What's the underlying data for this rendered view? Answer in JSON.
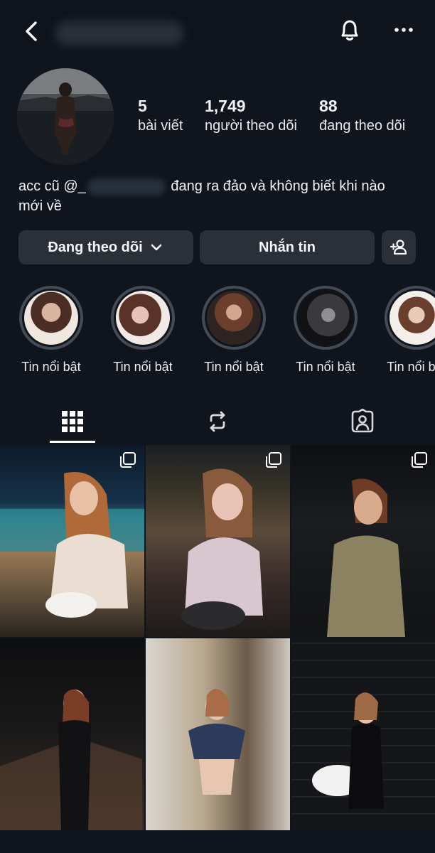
{
  "header": {
    "back_icon": "chevron-left-icon",
    "bell_icon": "bell-icon",
    "more_icon": "more-horizontal-icon"
  },
  "profile": {
    "stats": [
      {
        "value": "5",
        "label": "bài viết"
      },
      {
        "value": "1,749",
        "label": "người theo dõi"
      },
      {
        "value": "88",
        "label": "đang theo dõi"
      }
    ],
    "bio_before": "acc cũ @_",
    "bio_after": " đang ra đảo và không biết khi nào",
    "bio_line2": "mới về"
  },
  "actions": {
    "following_label": "Đang theo dõi",
    "message_label": "Nhắn tin",
    "add_user_icon": "add-person-icon"
  },
  "highlights": [
    {
      "label": "Tin nổi bật"
    },
    {
      "label": "Tin nổi bật"
    },
    {
      "label": "Tin nổi bật"
    },
    {
      "label": "Tin nổi bật"
    },
    {
      "label": "Tin nổi bật"
    }
  ],
  "tabs": [
    {
      "icon": "grid-icon",
      "active": true
    },
    {
      "icon": "reels-repost-icon",
      "active": false
    },
    {
      "icon": "tagged-person-icon",
      "active": false
    }
  ],
  "posts": [
    {
      "multi": true
    },
    {
      "multi": true
    },
    {
      "multi": true
    },
    {
      "multi": false
    },
    {
      "multi": false
    },
    {
      "multi": false
    }
  ],
  "colors": {
    "background": "#0f141d",
    "button": "#2a2f38",
    "ring": "#454b55"
  }
}
